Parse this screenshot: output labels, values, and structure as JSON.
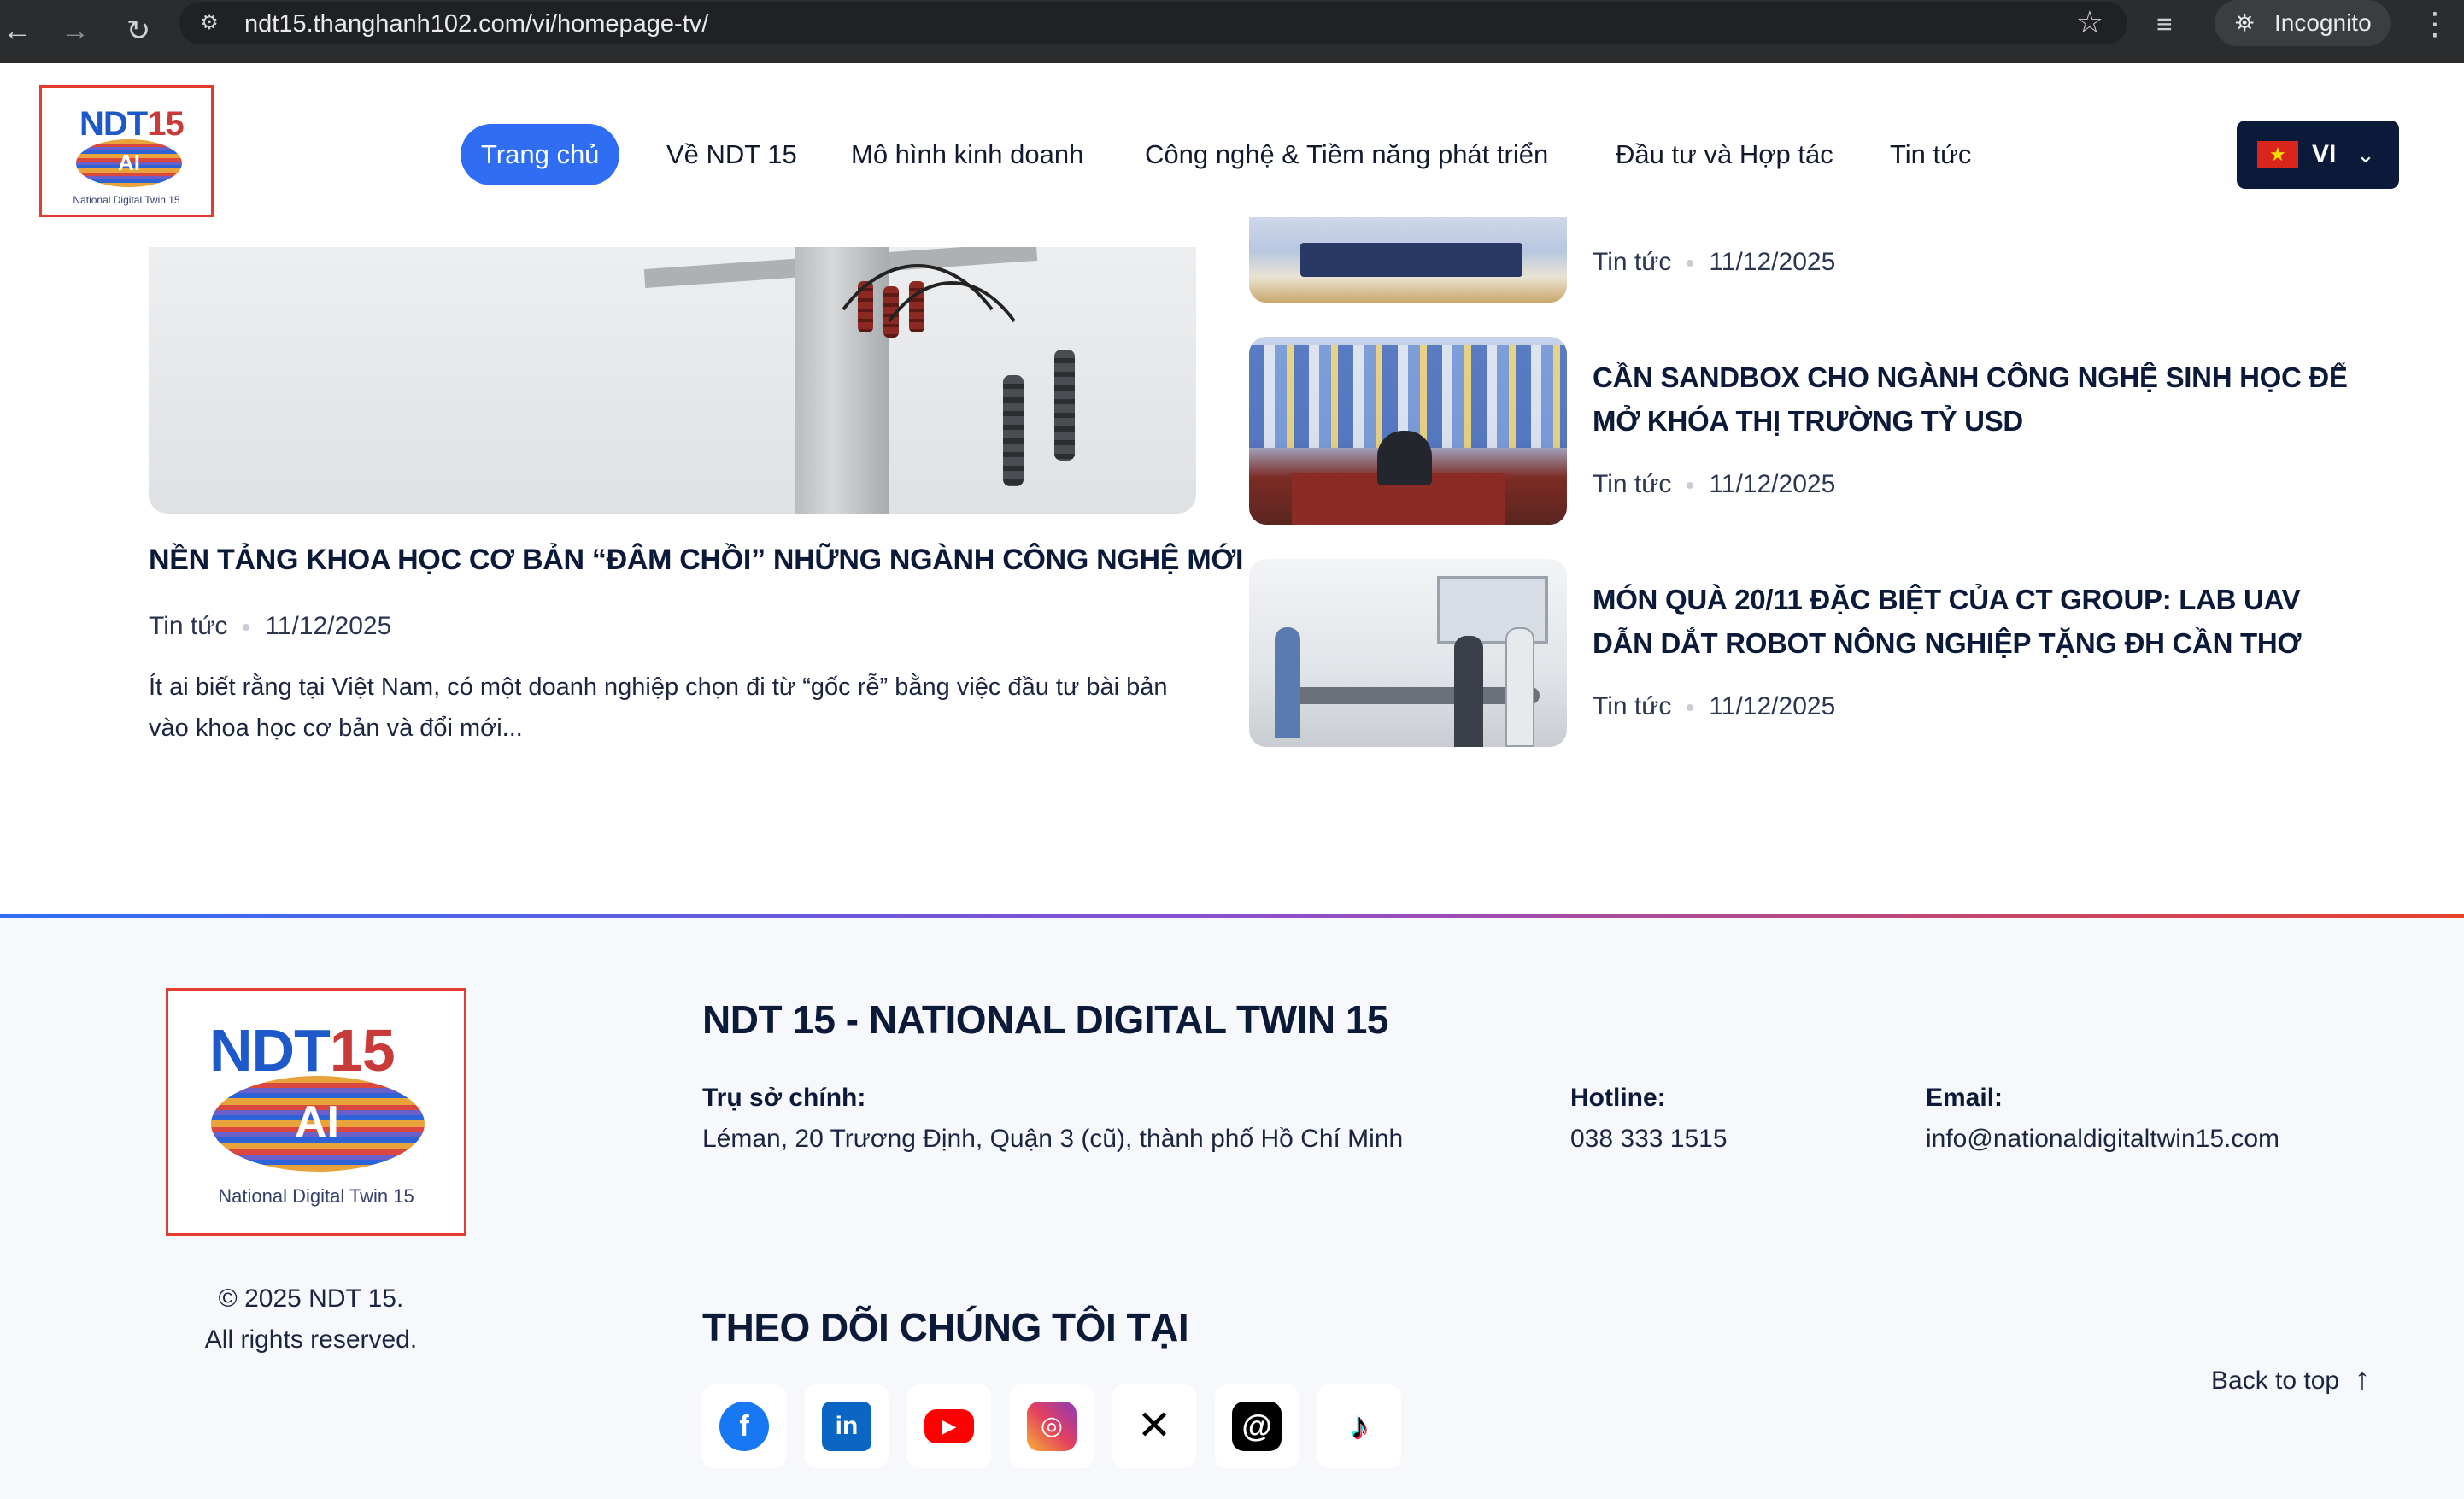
{
  "browser": {
    "url": "ndt15.thanghanh102.com/vi/homepage-tv/",
    "incognito_label": "Incognito",
    "icons": [
      "back-icon",
      "forward-icon",
      "reload-icon",
      "site-info-icon",
      "bookmark-star-icon",
      "media-control-icon",
      "incognito-icon",
      "more-menu-icon"
    ]
  },
  "logo": {
    "brand_ndt": "NDT",
    "brand_num": "15",
    "ai": "AI",
    "caption": "National Digital Twin 15"
  },
  "nav": {
    "items": [
      {
        "label": "Trang chủ",
        "active": true
      },
      {
        "label": "Về NDT 15"
      },
      {
        "label": "Mô hình kinh doanh"
      },
      {
        "label": "Công nghệ & Tiềm năng phát triển"
      },
      {
        "label": "Đầu tư và Hợp tác"
      },
      {
        "label": "Tin tức"
      }
    ],
    "language": "VI"
  },
  "featured": {
    "title": "NỀN TẢNG KHOA HỌC CƠ BẢN “ĐÂM CHỒI” NHỮNG NGÀNH CÔNG NGHỆ MỚI",
    "category": "Tin tức",
    "date": "11/12/2025",
    "excerpt": "Ít ai biết rằng tại Việt Nam, có một doanh nghiệp chọn đi từ “gốc rễ” bằng việc đầu tư bài bản vào khoa học cơ bản và đổi mới..."
  },
  "side_news": [
    {
      "title": "",
      "category": "Tin tức",
      "date": "11/12/2025"
    },
    {
      "title": "CẦN SANDBOX CHO NGÀNH CÔNG NGHỆ SINH HỌC ĐỂ MỞ KHÓA THỊ TRƯỜNG TỶ USD",
      "category": "Tin tức",
      "date": "11/12/2025"
    },
    {
      "title": "MÓN QUÀ 20/11 ĐẶC BIỆT CỦA CT GROUP: LAB UAV DẪN DẮT ROBOT NÔNG NGHIỆP TẶNG ĐH CẦN THƠ",
      "category": "Tin tức",
      "date": "11/12/2025"
    }
  ],
  "footer": {
    "company": "NDT 15 - NATIONAL DIGITAL TWIN 15",
    "hq_label": "Trụ sở chính:",
    "hq_value": "Léman, 20 Trương Định, Quận 3 (cũ), thành phố Hồ Chí Minh",
    "hotline_label": "Hotline:",
    "hotline_value": "038 333 1515",
    "email_label": "Email:",
    "email_value": "info@nationaldigitaltwin15.com",
    "copyright_1": "© 2025 NDT 15.",
    "copyright_2": "All rights reserved.",
    "follow_title": "THEO DÕI CHÚNG TÔI TẠI",
    "social": [
      "facebook-icon",
      "linkedin-icon",
      "youtube-icon",
      "instagram-icon",
      "x-icon",
      "threads-icon",
      "tiktok-icon"
    ],
    "back_to_top": "Back to top"
  },
  "colors": {
    "accent": "#2f6ef3",
    "navy": "#0c1a3a",
    "logo_border": "#e33b2e"
  }
}
